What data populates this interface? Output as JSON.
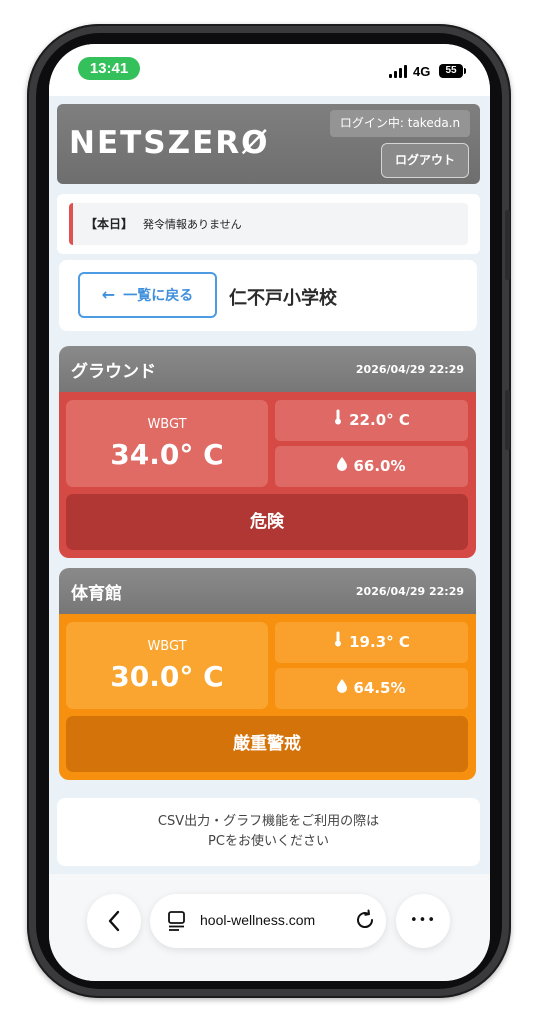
{
  "status": {
    "time": "13:41",
    "network": "4G",
    "battery": "55"
  },
  "header": {
    "logo": "NETSZERØ",
    "login_status": "ログイン中: takeda.n",
    "logout_label": "ログアウト"
  },
  "notice": {
    "tag": "【本日】",
    "text": "発令情報ありません"
  },
  "school": {
    "back_label": "一覧に戻る",
    "back_arrow": "←",
    "name": "仁不戸小学校"
  },
  "measurements": [
    {
      "location": "グラウンド",
      "datetime": "2026/04/29 22:29",
      "wbgt_label": "WBGT",
      "wbgt": "34.0° C",
      "temperature": "22.0° C",
      "humidity": "66.0%",
      "level": "危険",
      "level_color": "#d54a44"
    },
    {
      "location": "体育館",
      "datetime": "2026/04/29 22:29",
      "wbgt_label": "WBGT",
      "wbgt": "30.0° C",
      "temperature": "19.3° C",
      "humidity": "64.5%",
      "level": "厳重警戒",
      "level_color": "#f7900f"
    }
  ],
  "pc_notice": {
    "line1": "CSV出力・グラフ機能をご利用の際は",
    "line2": "PCをお使いください"
  },
  "browser": {
    "url": "hool-wellness.com",
    "back_icon": "chevron-left-icon",
    "more_icon": "ellipsis-icon",
    "more_glyph": "•••"
  }
}
